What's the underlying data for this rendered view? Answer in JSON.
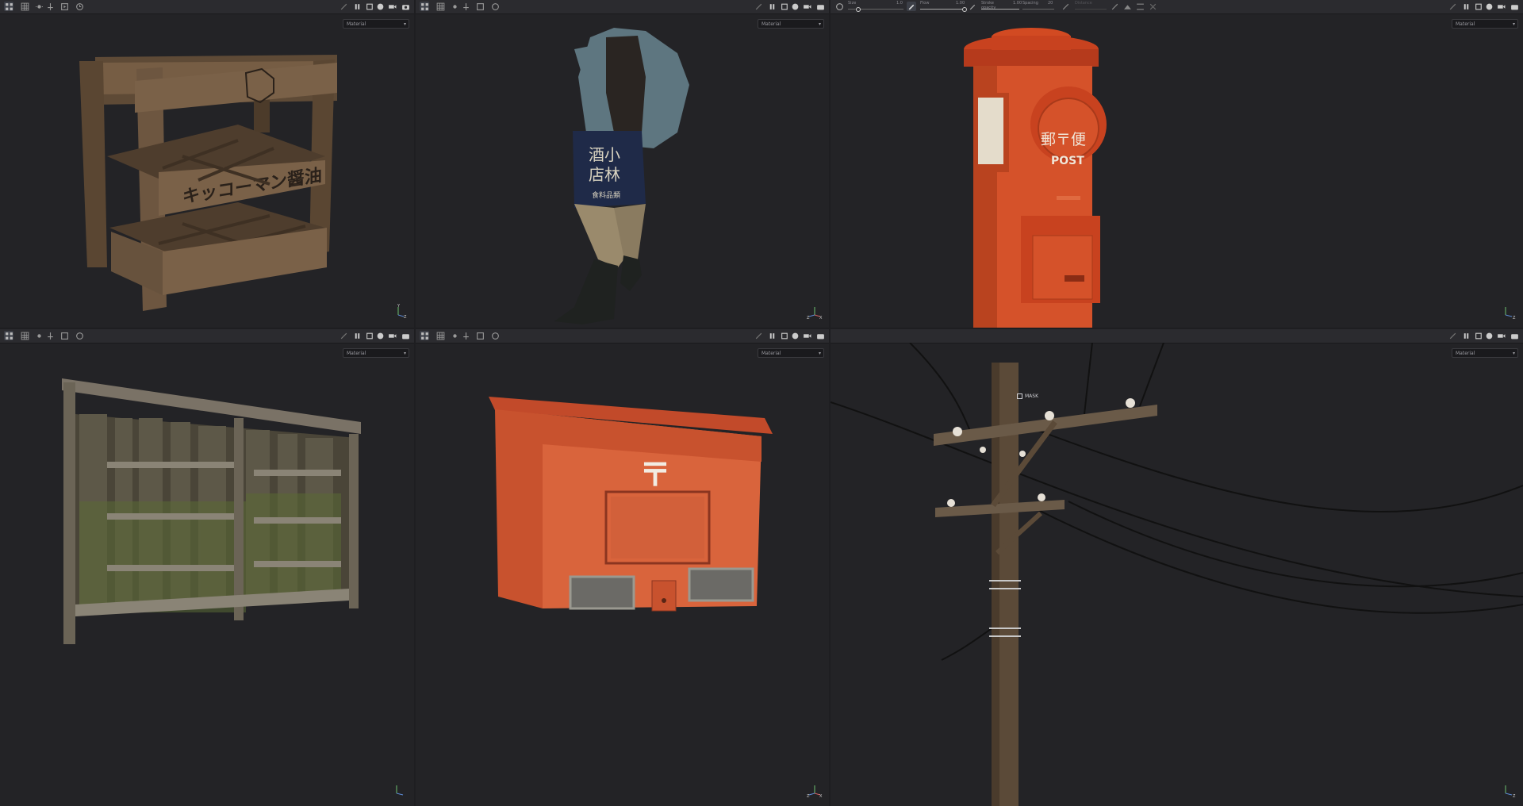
{
  "viewports": [
    {
      "id": "crate",
      "dropdown": "Material"
    },
    {
      "id": "figure",
      "dropdown": "Material"
    },
    {
      "id": "postbox",
      "dropdown": "Material"
    },
    {
      "id": "fence",
      "dropdown": "Material"
    },
    {
      "id": "mailbox",
      "dropdown": "Material"
    },
    {
      "id": "pole",
      "dropdown": "Material"
    }
  ],
  "brush": {
    "size_label": "Size",
    "size_value": "1.0",
    "flow_label": "Flow",
    "flow_value": "1.00",
    "stroke_opacity_label": "Stroke opacity",
    "stroke_opacity_value": "1.00",
    "spacing_label": "Spacing",
    "spacing_value": "20",
    "distance_label": "Distance"
  },
  "mask_label": "MASK",
  "crate_text": "キッコーマン醤油",
  "apron_text": [
    "酒小",
    "店林"
  ],
  "apron_sub": "食料品類",
  "postbox_text": "郵〒便",
  "postbox_sub": "POST",
  "mailbox_mark": "〒",
  "gizmo_axes": {
    "x": "X",
    "y": "Y",
    "z": "Z"
  },
  "colors": {
    "bg": "#232326",
    "toolbar": "#2b2b2f",
    "accent_orange": "#d9562a",
    "wood": "#6b5540"
  }
}
